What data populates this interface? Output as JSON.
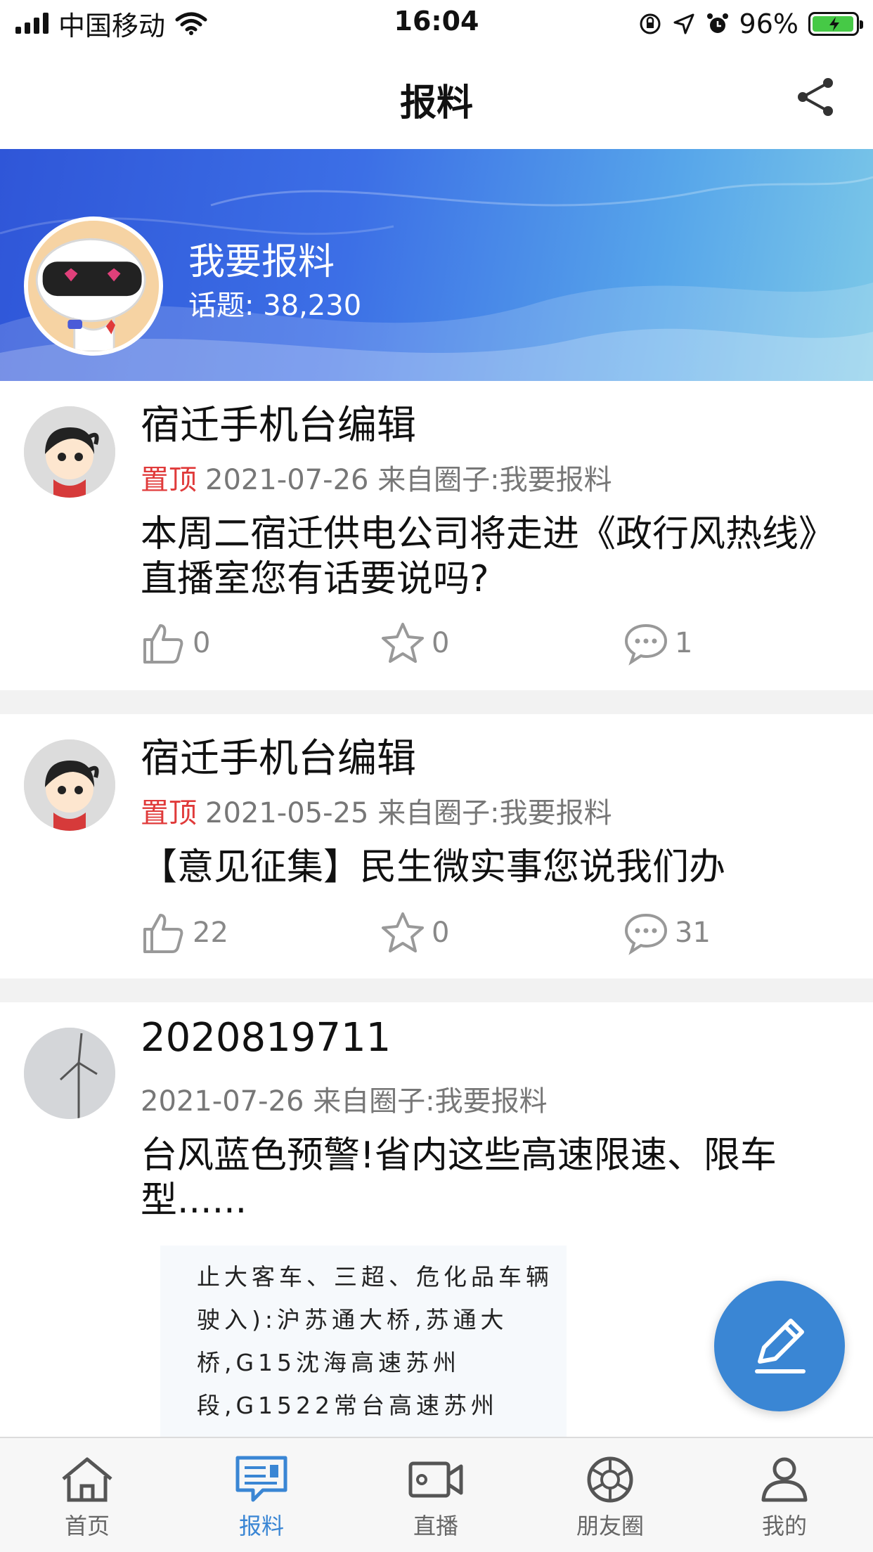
{
  "status_bar": {
    "carrier": "中国移动",
    "time": "16:04",
    "battery_percent": "96%",
    "battery_level": 0.96,
    "icons": [
      "signal-icon",
      "wifi-icon",
      "orientation-lock-icon",
      "location-icon",
      "alarm-icon",
      "battery-charging-icon"
    ]
  },
  "nav": {
    "title": "报料",
    "share_icon": "share-icon"
  },
  "banner": {
    "title": "我要报料",
    "topic_count": "话题: 38,230"
  },
  "posts": [
    {
      "author": "宿迁手机台编辑",
      "pinned_label": "置顶",
      "date": "2021-07-26",
      "source": "来自圈子:我要报料",
      "text": "本周二宿迁供电公司将走进《政行风热线》直播室您有话要说吗?",
      "likes": "0",
      "favorites": "0",
      "comments": "1"
    },
    {
      "author": "宿迁手机台编辑",
      "pinned_label": "置顶",
      "date": "2021-05-25",
      "source": "来自圈子:我要报料",
      "text": "【意见征集】民生微实事您说我们办",
      "likes": "22",
      "favorites": "0",
      "comments": "31"
    },
    {
      "author": "2020819711",
      "date": "2021-07-26",
      "source": "来自圈子:我要报料",
      "text": "台风蓝色预警!省内这些高速限速、限车型......",
      "image_text": "止大客车、三超、危化品车辆驶入):沪苏通大桥,苏通大桥,G15沈海高速苏州段,G1522常台高速苏州"
    }
  ],
  "fab": {
    "icon": "edit-icon"
  },
  "tabs": [
    {
      "label": "首页",
      "icon": "home-icon",
      "active": false
    },
    {
      "label": "报料",
      "icon": "report-icon",
      "active": true
    },
    {
      "label": "直播",
      "icon": "live-camera-icon",
      "active": false
    },
    {
      "label": "朋友圈",
      "icon": "moments-icon",
      "active": false
    },
    {
      "label": "我的",
      "icon": "profile-icon",
      "active": false
    }
  ],
  "colors": {
    "accent": "#3a86d4",
    "pinned": "#e03a3a",
    "banner_start": "#2f56d8",
    "banner_end": "#7cc8e8"
  }
}
